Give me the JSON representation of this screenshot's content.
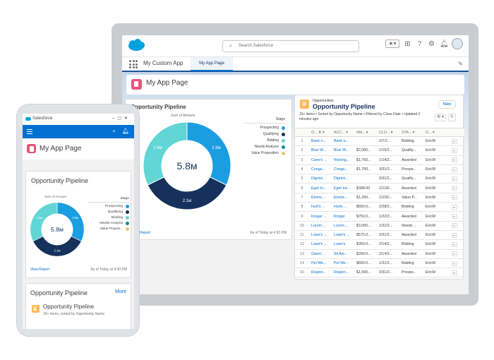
{
  "laptop": {
    "search_placeholder": "Search Salesforce",
    "app_name": "My Custom App",
    "active_tab": "My App Page",
    "page_title": "My App Page",
    "pipeline_card": {
      "title": "Opportunity Pipeline",
      "sum_label": "Sum of Amount",
      "center_value": "5.8м",
      "footer_link": "Report",
      "footer_right": "As of Today at 4:30 PM",
      "legend_title": "Stage"
    },
    "opportunities": {
      "object_label": "Opportunities",
      "title": "Opportunity Pipeline",
      "subtitle": "15+ items • Sorted by Opportunity Name • Filtered by Close Date • Updated 2 minutes ago",
      "new_label": "New",
      "settings_label": "⚙ ▾",
      "refresh_label": "↻",
      "columns": [
        "O... ⬆ ▾",
        "ACC... ▾",
        "AM... ▾",
        "CLO... ▾",
        "STA... ▾",
        "O... ▾"
      ],
      "rows": [
        [
          "1",
          "Bank o...",
          "Bank o...",
          "",
          "2/7/2...",
          "Bidding",
          "EricW"
        ],
        [
          "2",
          "Blue W...",
          "Blue W...",
          "$2,000...",
          "1/15/2...",
          "Qualify...",
          "EricW"
        ],
        [
          "3",
          "Cane's ...",
          "Raising...",
          "$1,750...",
          "1/14/2...",
          "Awarded",
          "EricW"
        ],
        [
          "4",
          "Congu...",
          "Congu...",
          "$1,700...",
          "3/31/2...",
          "Prospe...",
          "EricW"
        ],
        [
          "5",
          "Dignisi...",
          "Dignisi...",
          "",
          "3/31/2...",
          "Qualify...",
          "EricW"
        ],
        [
          "6",
          "Eget In...",
          "Eget Inc...",
          "$398.00",
          "12/18/...",
          "Awarded",
          "EricW"
        ],
        [
          "7",
          "Eleme...",
          "Eleme...",
          "$1,200...",
          "12/20/...",
          "Value P...",
          "EricW"
        ],
        [
          "8",
          "Hurt's ...",
          "Hurts ...",
          "$650.0...",
          "2/28/2...",
          "Bidding",
          "EricW"
        ],
        [
          "9",
          "Kroger ...",
          "Kroger",
          "$750.0...",
          "1/22/2...",
          "Awarded",
          "EricW"
        ],
        [
          "10",
          "Lorem ...",
          "Lorem ...",
          "$3,000...",
          "1/31/2...",
          "Needs ...",
          "EricW"
        ],
        [
          "11",
          "Lowe's ...",
          "Lowe's ...",
          "$575.0...",
          "3/31/2...",
          "Awarded",
          "EricW"
        ],
        [
          "12",
          "Lowe's ...",
          "Lowe's",
          "$350.0...",
          "2/14/2...",
          "Bidding",
          "EricW"
        ],
        [
          "13",
          "Owen'...",
          "Sit Am...",
          "$200.0...",
          "2/14/2...",
          "Awarded",
          "EricW"
        ],
        [
          "14",
          "Pel We...",
          "Pel We...",
          "$600.0...",
          "1/31/2...",
          "Bidding",
          "EricW"
        ],
        [
          "15",
          "Region...",
          "Region...",
          "$1,500...",
          "3/31/2...",
          "Prospe...",
          "EricW"
        ]
      ]
    }
  },
  "phone": {
    "app_name": "Salesforce",
    "page_title": "My App Page",
    "pipeline_card": {
      "title": "Opportunity Pipeline",
      "sum_label": "Sum of Amount",
      "center_value": "5.8м",
      "footer_link": "View Report",
      "footer_right": "As of Today at 4:30 PM",
      "legend_title": "Stage"
    },
    "list_card": {
      "title": "Opportunity Pipeline",
      "more_label": "More",
      "item_title": "Opportunity Pipeline",
      "item_subtitle": "15+ items, sorted by Opportunity Name"
    }
  },
  "chart_data": {
    "type": "pie",
    "title": "Sum of Amount",
    "center_label": "5.8м",
    "legend_title": "Stage",
    "categories": [
      "Prospecting",
      "Qualifying",
      "Bidding",
      "Needs Analysis",
      "Value Proposition"
    ],
    "values": [
      1.9,
      2.1,
      1.9,
      0,
      0
    ],
    "slice_labels": [
      "1.9м",
      "2.1м",
      "1.9м",
      "",
      ""
    ],
    "phone_legend_labels": [
      "Prospecting",
      "Qualifying",
      "Bidding",
      "Needs Analysis",
      "Value Propos..."
    ],
    "colors": [
      "#1b9de2",
      "#16325c",
      "#62d5d5",
      "#0c8a99",
      "#e7c86e"
    ]
  }
}
